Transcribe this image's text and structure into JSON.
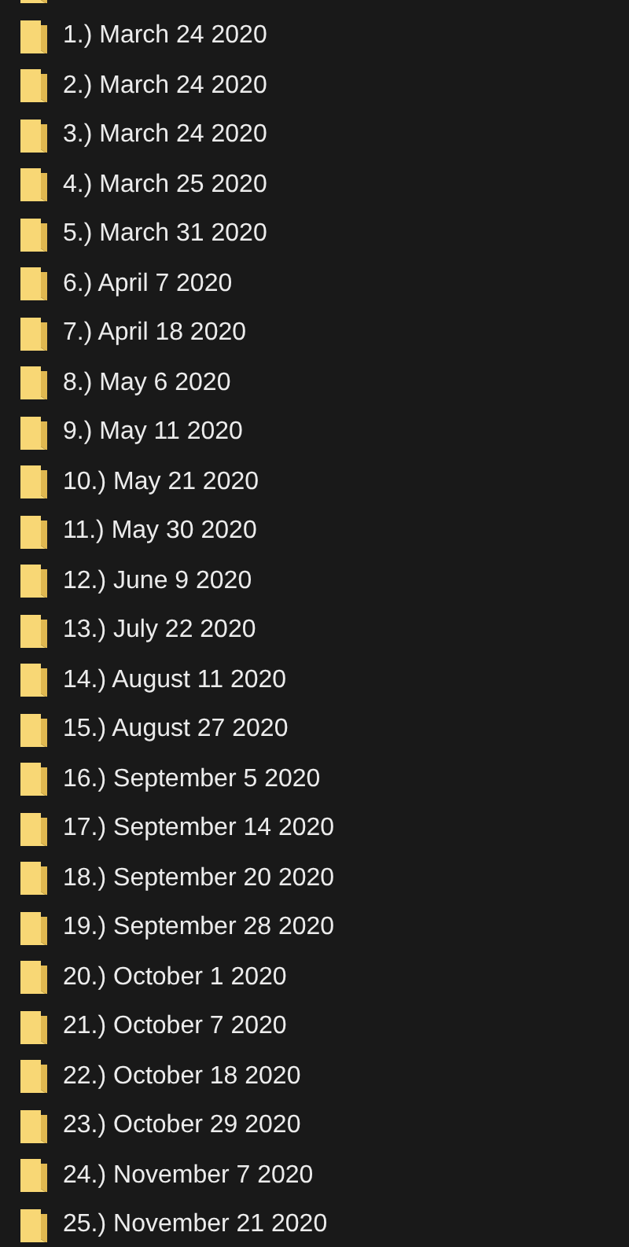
{
  "folders": [
    {
      "name": "1.) March 24 2020"
    },
    {
      "name": "2.) March 24 2020"
    },
    {
      "name": "3.) March 24 2020"
    },
    {
      "name": "4.) March 25 2020"
    },
    {
      "name": "5.) March 31 2020"
    },
    {
      "name": "6.) April 7 2020"
    },
    {
      "name": "7.) April 18 2020"
    },
    {
      "name": "8.) May 6 2020"
    },
    {
      "name": "9.) May 11 2020"
    },
    {
      "name": "10.) May 21 2020"
    },
    {
      "name": "11.) May 30 2020"
    },
    {
      "name": "12.) June 9 2020"
    },
    {
      "name": "13.) July 22 2020"
    },
    {
      "name": "14.) August 11 2020"
    },
    {
      "name": "15.) August 27 2020"
    },
    {
      "name": "16.) September 5 2020"
    },
    {
      "name": "17.) September 14 2020"
    },
    {
      "name": "18.) September 20 2020"
    },
    {
      "name": "19.) September 28 2020"
    },
    {
      "name": "20.) October 1 2020"
    },
    {
      "name": "21.) October 7 2020"
    },
    {
      "name": "22.) October 18 2020"
    },
    {
      "name": "23.) October 29 2020"
    },
    {
      "name": "24.) November 7 2020"
    },
    {
      "name": "25.) November 21 2020"
    }
  ]
}
